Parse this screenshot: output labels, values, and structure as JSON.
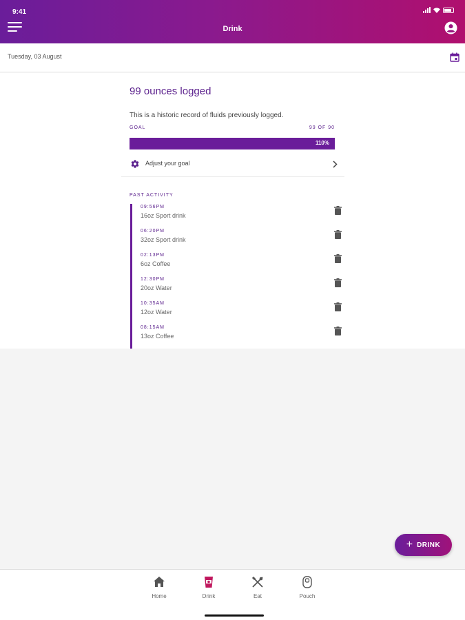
{
  "status_bar": {
    "time": "9:41"
  },
  "header": {
    "title": "Drink"
  },
  "date_bar": {
    "date": "Tuesday, 03 August"
  },
  "summary": {
    "title": "99 ounces logged",
    "description": "This is a historic record of fluids previously logged.",
    "goal_label": "GOAL",
    "goal_value": "99 OF 90",
    "progress_label": "110%",
    "progress_fraction": 1.1,
    "adjust_label": "Adjust your goal"
  },
  "past_activity": {
    "label": "PAST ACTIVITY",
    "items": [
      {
        "time": "09:56PM",
        "description": "16oz Sport drink"
      },
      {
        "time": "06:20PM",
        "description": "32oz Sport drink"
      },
      {
        "time": "02:13PM",
        "description": "6oz Coffee"
      },
      {
        "time": "12:30PM",
        "description": "20oz Water"
      },
      {
        "time": "10:35AM",
        "description": "12oz Water"
      },
      {
        "time": "08:15AM",
        "description": "13oz Coffee"
      }
    ]
  },
  "fab": {
    "label": "DRINK"
  },
  "nav": {
    "home": "Home",
    "drink": "Drink",
    "eat": "Eat",
    "pouch": "Pouch"
  },
  "colors": {
    "accent": "#6a1d9a",
    "active": "#c0185e"
  }
}
